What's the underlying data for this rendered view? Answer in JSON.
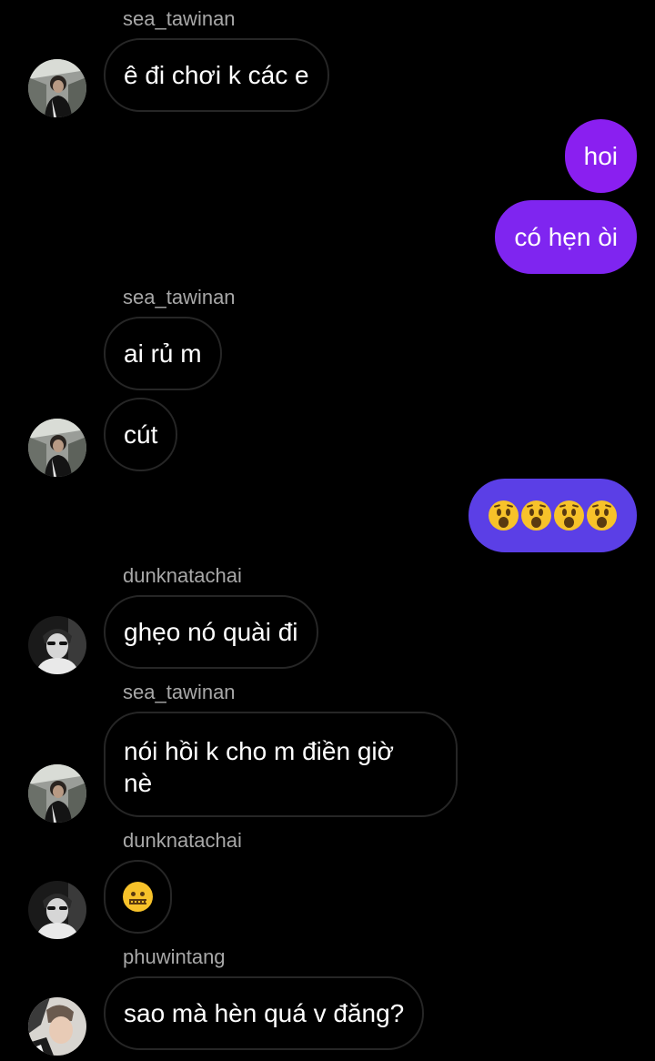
{
  "theme": {
    "background": "#000000",
    "incoming_border": "#262626",
    "outgoing_color_top": "#8a1ff0",
    "outgoing_color_bottom": "#5b3fe6",
    "sender_color": "#a8a8a8"
  },
  "messages": [
    {
      "type": "incoming",
      "sender": "sea_tawinan",
      "text": "ê đi chơi k các e",
      "avatar": "avatar-sea"
    },
    {
      "type": "outgoing",
      "text": "hoi"
    },
    {
      "type": "outgoing",
      "text": "có hẹn òi"
    },
    {
      "type": "incoming",
      "sender": "sea_tawinan",
      "text": "ai rủ m"
    },
    {
      "type": "incoming",
      "text": "cút",
      "avatar": "avatar-sea"
    },
    {
      "type": "outgoing",
      "emoji": [
        "hushed-face-emoji",
        "hushed-face-emoji",
        "hushed-face-emoji",
        "hushed-face-emoji"
      ]
    },
    {
      "type": "incoming",
      "sender": "dunknatachai",
      "text": "ghẹo nó quài đi",
      "avatar": "avatar-dunk"
    },
    {
      "type": "incoming",
      "sender": "sea_tawinan",
      "text_line1": "nói hồi k cho m điền giờ",
      "text_line2": "nè",
      "avatar": "avatar-sea"
    },
    {
      "type": "incoming",
      "sender": "dunknatachai",
      "emoji": [
        "zipper-mouth-face-emoji"
      ],
      "avatar": "avatar-dunk"
    },
    {
      "type": "incoming",
      "sender": "phuwintang",
      "text": "sao mà hèn quá v đăng?",
      "avatar": "avatar-phuwin"
    }
  ]
}
